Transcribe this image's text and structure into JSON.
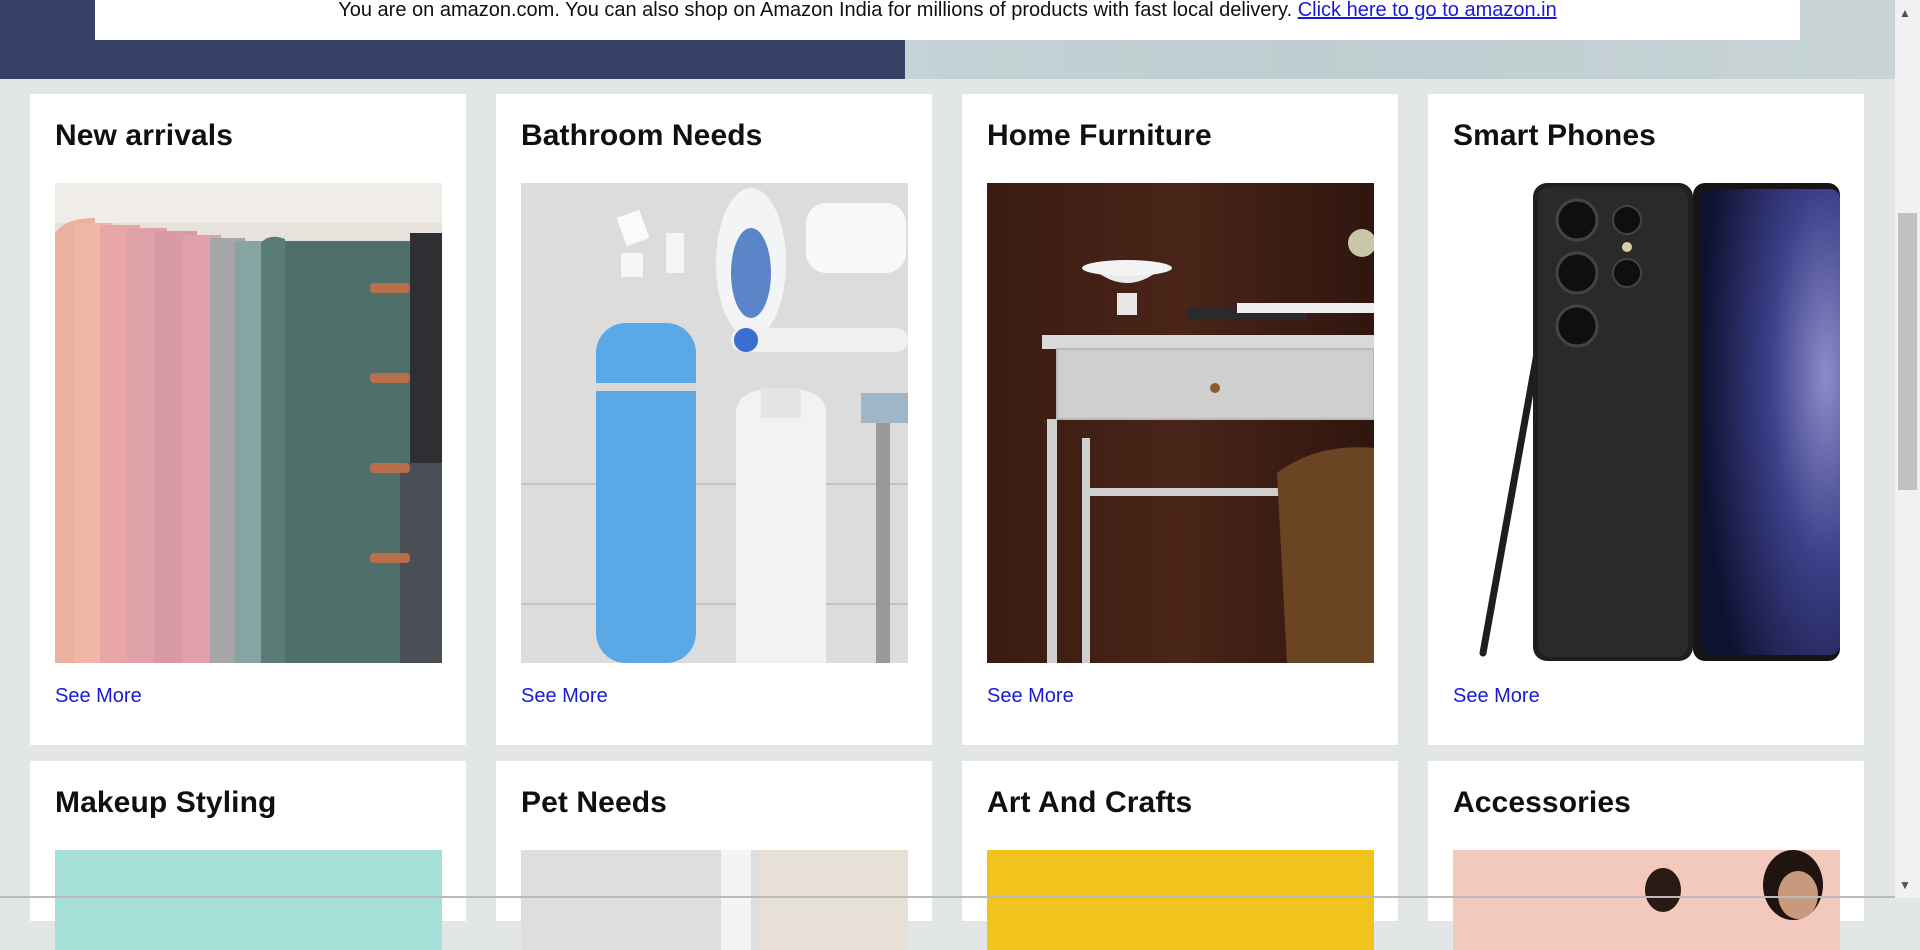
{
  "notice": {
    "message": "You are on amazon.com. You can also shop on Amazon India for millions of products with fast local delivery.",
    "link": "Click here to go to amazon.in"
  },
  "cards": [
    {
      "title": "New arrivals",
      "link": "See More",
      "image": "hanging-scarves-image"
    },
    {
      "title": "Bathroom Needs",
      "link": "See More",
      "image": "toiletries-image"
    },
    {
      "title": "Home Furniture",
      "link": "See More",
      "image": "side-table-image"
    },
    {
      "title": "Smart Phones",
      "link": "See More",
      "image": "smartphone-image"
    },
    {
      "title": "Makeup Styling",
      "image": "makeup-image"
    },
    {
      "title": "Pet Needs",
      "image": "pet-image"
    },
    {
      "title": "Art And Crafts",
      "image": "art-crafts-image"
    },
    {
      "title": "Accessories",
      "image": "accessories-image"
    }
  ],
  "colors": {
    "link": "#1a1ad6",
    "page_background": "#e3e6e6",
    "hero_dark": "#354265"
  },
  "scrollbar": {
    "up_icon": "triangle-up",
    "down_icon": "triangle-down"
  }
}
